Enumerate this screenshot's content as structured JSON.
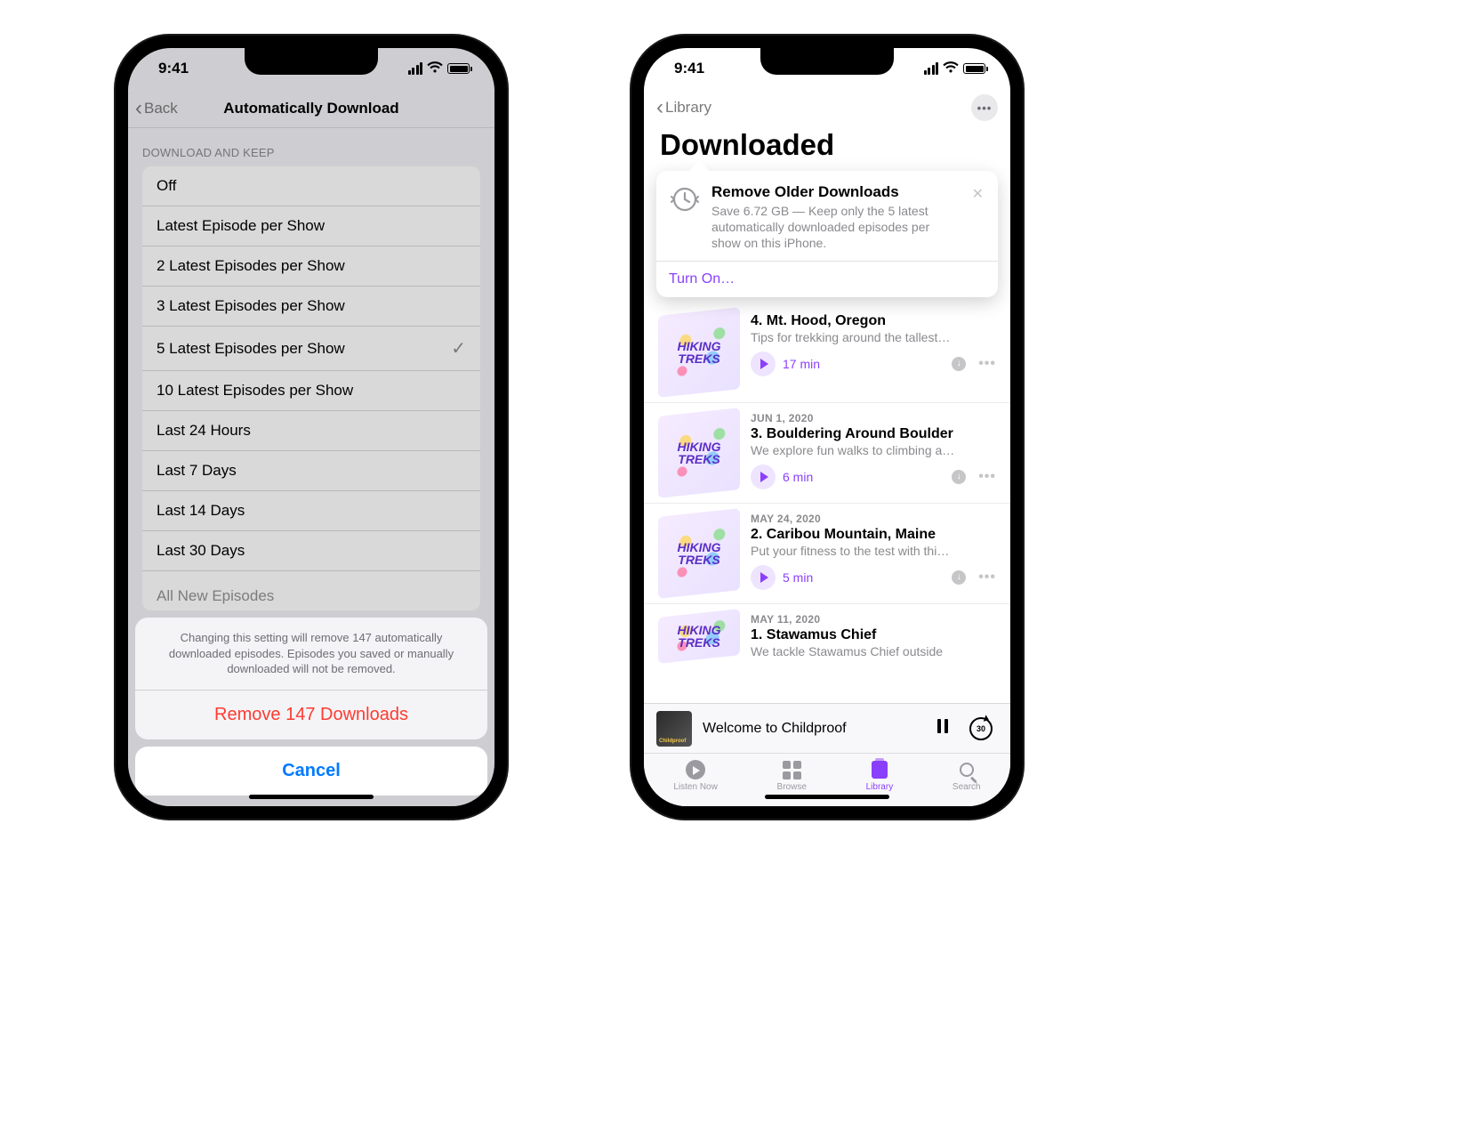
{
  "status": {
    "time": "9:41"
  },
  "phone1": {
    "nav": {
      "back": "Back",
      "title": "Automatically Download"
    },
    "section_header": "DOWNLOAD AND KEEP",
    "options": [
      "Off",
      "Latest Episode per Show",
      "2 Latest Episodes per Show",
      "3 Latest Episodes per Show",
      "5 Latest Episodes per Show",
      "10 Latest Episodes per Show",
      "Last 24 Hours",
      "Last 7 Days",
      "Last 14 Days",
      "Last 30 Days",
      "All New Episodes"
    ],
    "selected_index": 4,
    "sheet": {
      "message": "Changing this setting will remove 147 automatically downloaded episodes. Episodes you saved or manually downloaded will not be removed.",
      "destructive": "Remove 147 Downloads",
      "cancel": "Cancel"
    }
  },
  "phone2": {
    "nav": {
      "back": "Library"
    },
    "title": "Downloaded",
    "tip": {
      "title": "Remove Older Downloads",
      "subtitle": "Save 6.72 GB — Keep only the 5 latest automatically downloaded episodes per show on this iPhone.",
      "action": "Turn On…"
    },
    "artwork_text": "HIKING\nTREKS",
    "episodes": [
      {
        "date": "",
        "title": "4. Mt. Hood, Oregon",
        "desc": "Tips for trekking around the tallest…",
        "duration": "17 min"
      },
      {
        "date": "JUN 1, 2020",
        "title": "3. Bouldering Around Boulder",
        "desc": "We explore fun walks to climbing a…",
        "duration": "6 min"
      },
      {
        "date": "MAY 24, 2020",
        "title": "2. Caribou Mountain, Maine",
        "desc": "Put your fitness to the test with thi…",
        "duration": "5 min"
      },
      {
        "date": "MAY 11, 2020",
        "title": "1. Stawamus Chief",
        "desc": "We tackle Stawamus Chief outside",
        "duration": ""
      }
    ],
    "now_playing": {
      "title": "Welcome to Childproof",
      "art_label": "Childproof"
    },
    "tabs": {
      "listen": "Listen Now",
      "browse": "Browse",
      "library": "Library",
      "search": "Search"
    }
  }
}
